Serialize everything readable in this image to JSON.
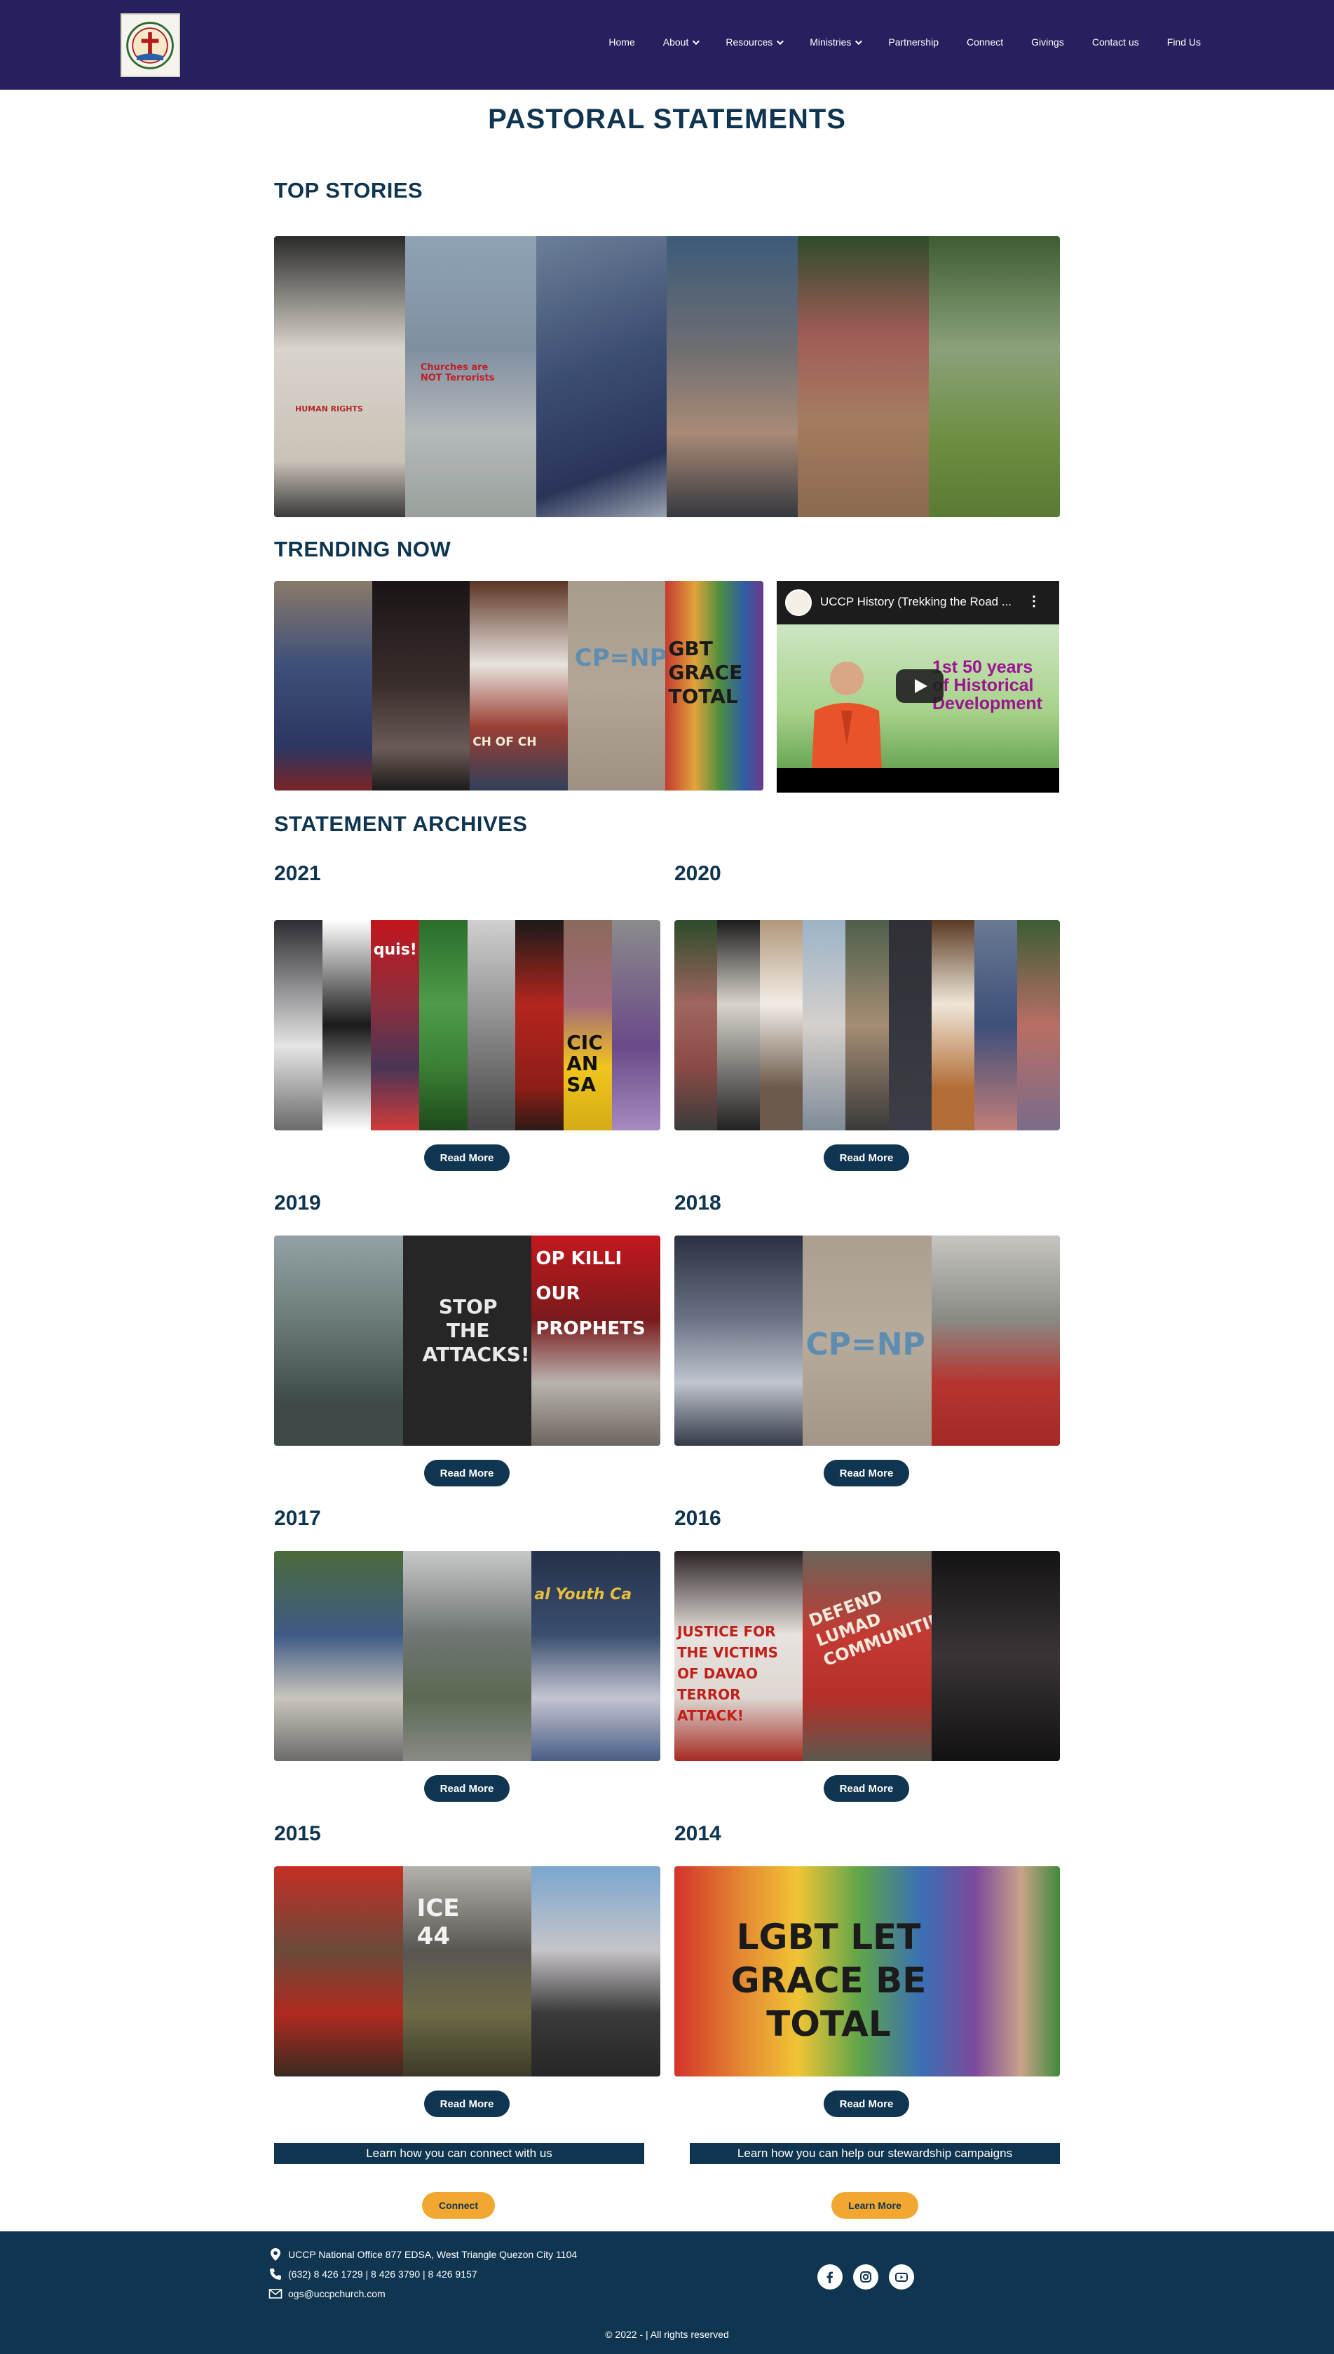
{
  "nav": {
    "items": [
      {
        "label": "Home",
        "dropdown": false
      },
      {
        "label": "About",
        "dropdown": true
      },
      {
        "label": "Resources",
        "dropdown": true
      },
      {
        "label": "Ministries",
        "dropdown": true
      },
      {
        "label": "Partnership",
        "dropdown": false
      },
      {
        "label": "Connect",
        "dropdown": false
      },
      {
        "label": "Givings",
        "dropdown": false
      },
      {
        "label": "Contact us",
        "dropdown": false
      },
      {
        "label": "Find Us",
        "dropdown": false
      }
    ],
    "background": "#27205e"
  },
  "page_title": "PASTORAL STATEMENTS",
  "sections": {
    "top_stories": "TOP STORIES",
    "trending_now": "TRENDING NOW",
    "statement_archives": "STATEMENT ARCHIVES"
  },
  "collage_text": {
    "top_1": "HUMAN RIGHTS",
    "top_2": "Churches are NOT Terrorists",
    "trend_1": "CH OF CH",
    "trend_2": "CP=NP",
    "trend_3": "GBT GRACE TOTAL",
    "y2021_1": "quis!",
    "y2021_2": "CIC AN SA",
    "y2019_1": "STOP THE ATTACKS!",
    "y2019_2": "OP KILLI OUR PROPHETS",
    "y2018_1": "CP=NP",
    "y2017_1": "al Youth Ca",
    "y2016_1": "JUSTICE FOR THE VICTIMS OF DAVAO TERROR ATTACK!",
    "y2016_2": "DEFEND LUMAD COMMUNITIES",
    "y2015_1": "ICE 44",
    "y2014_1": "LGBT LET GRACE BE TOTAL"
  },
  "video": {
    "title": "UCCP History (Trekking the Road ...",
    "overlay": "1st 50 years of Historical Development"
  },
  "archives": [
    {
      "year": "2021",
      "button": "Read More"
    },
    {
      "year": "2020",
      "button": "Read More"
    },
    {
      "year": "2019",
      "button": "Read More"
    },
    {
      "year": "2018",
      "button": "Read More"
    },
    {
      "year": "2017",
      "button": "Read More"
    },
    {
      "year": "2016",
      "button": "Read More"
    },
    {
      "year": "2015",
      "button": "Read More"
    },
    {
      "year": "2014",
      "button": "Read More"
    }
  ],
  "cta": {
    "connect_text": "Learn how you can connect with us",
    "connect_button": "Connect",
    "steward_text": "Learn how you can help our stewardship campaigns",
    "steward_button": "Learn More"
  },
  "footer": {
    "address": "UCCP National Office 877 EDSA, West Triangle Quezon City 1104",
    "phone": "(632) 8 426 1729 | 8 426 3790 | 8 426 9157",
    "email": "ogs@uccpchurch.com",
    "copyright": "© 2022 - | All rights reserved",
    "socials": [
      "facebook-icon",
      "instagram-icon",
      "youtube-icon"
    ]
  },
  "colors": {
    "primary": "#0f3550",
    "nav": "#27205e",
    "accent": "#f2a830"
  }
}
